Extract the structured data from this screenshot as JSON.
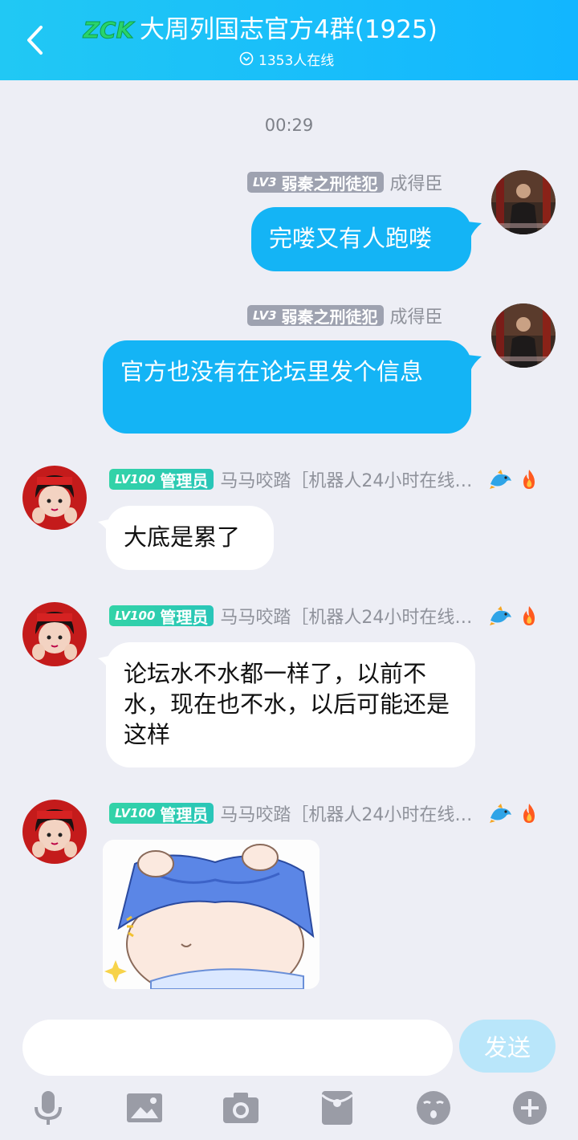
{
  "header": {
    "title": "大周列国志官方4群(1925)",
    "online": "1353人在线",
    "logo_text": "ZCK"
  },
  "chat": {
    "time": "00:29",
    "messages": [
      {
        "side": "right",
        "level": "LV3",
        "title": "弱秦之刑徒犯",
        "nick": "成得臣",
        "text": "完喽又有人跑喽"
      },
      {
        "side": "right",
        "level": "LV3",
        "title": "弱秦之刑徒犯",
        "nick": "成得臣",
        "text": "官方也没有在论坛里发个信息"
      },
      {
        "side": "left",
        "level": "LV100",
        "title": "管理员",
        "nick": "马马咬踏［机器人24小时在线…",
        "text": "大底是累了"
      },
      {
        "side": "left",
        "level": "LV100",
        "title": "管理员",
        "nick": "马马咬踏［机器人24小时在线…",
        "text": "论坛水不水都一样了，以前不水，现在也不水，以后可能还是这样"
      },
      {
        "side": "left",
        "level": "LV100",
        "title": "管理员",
        "nick": "马马咬踏［机器人24小时在线…",
        "sticker": "belly-sticker"
      }
    ]
  },
  "input": {
    "placeholder": "",
    "send_label": "发送"
  },
  "toolbar": {
    "icons": [
      "mic-icon",
      "image-icon",
      "camera-icon",
      "red-packet-icon",
      "emoji-icon",
      "plus-icon"
    ]
  },
  "colors": {
    "header": "#14b6fc",
    "bubble_right": "#14b4f5",
    "bubble_left": "#ffffff",
    "send_button": "#b9e6fa",
    "background": "#edeef5"
  }
}
